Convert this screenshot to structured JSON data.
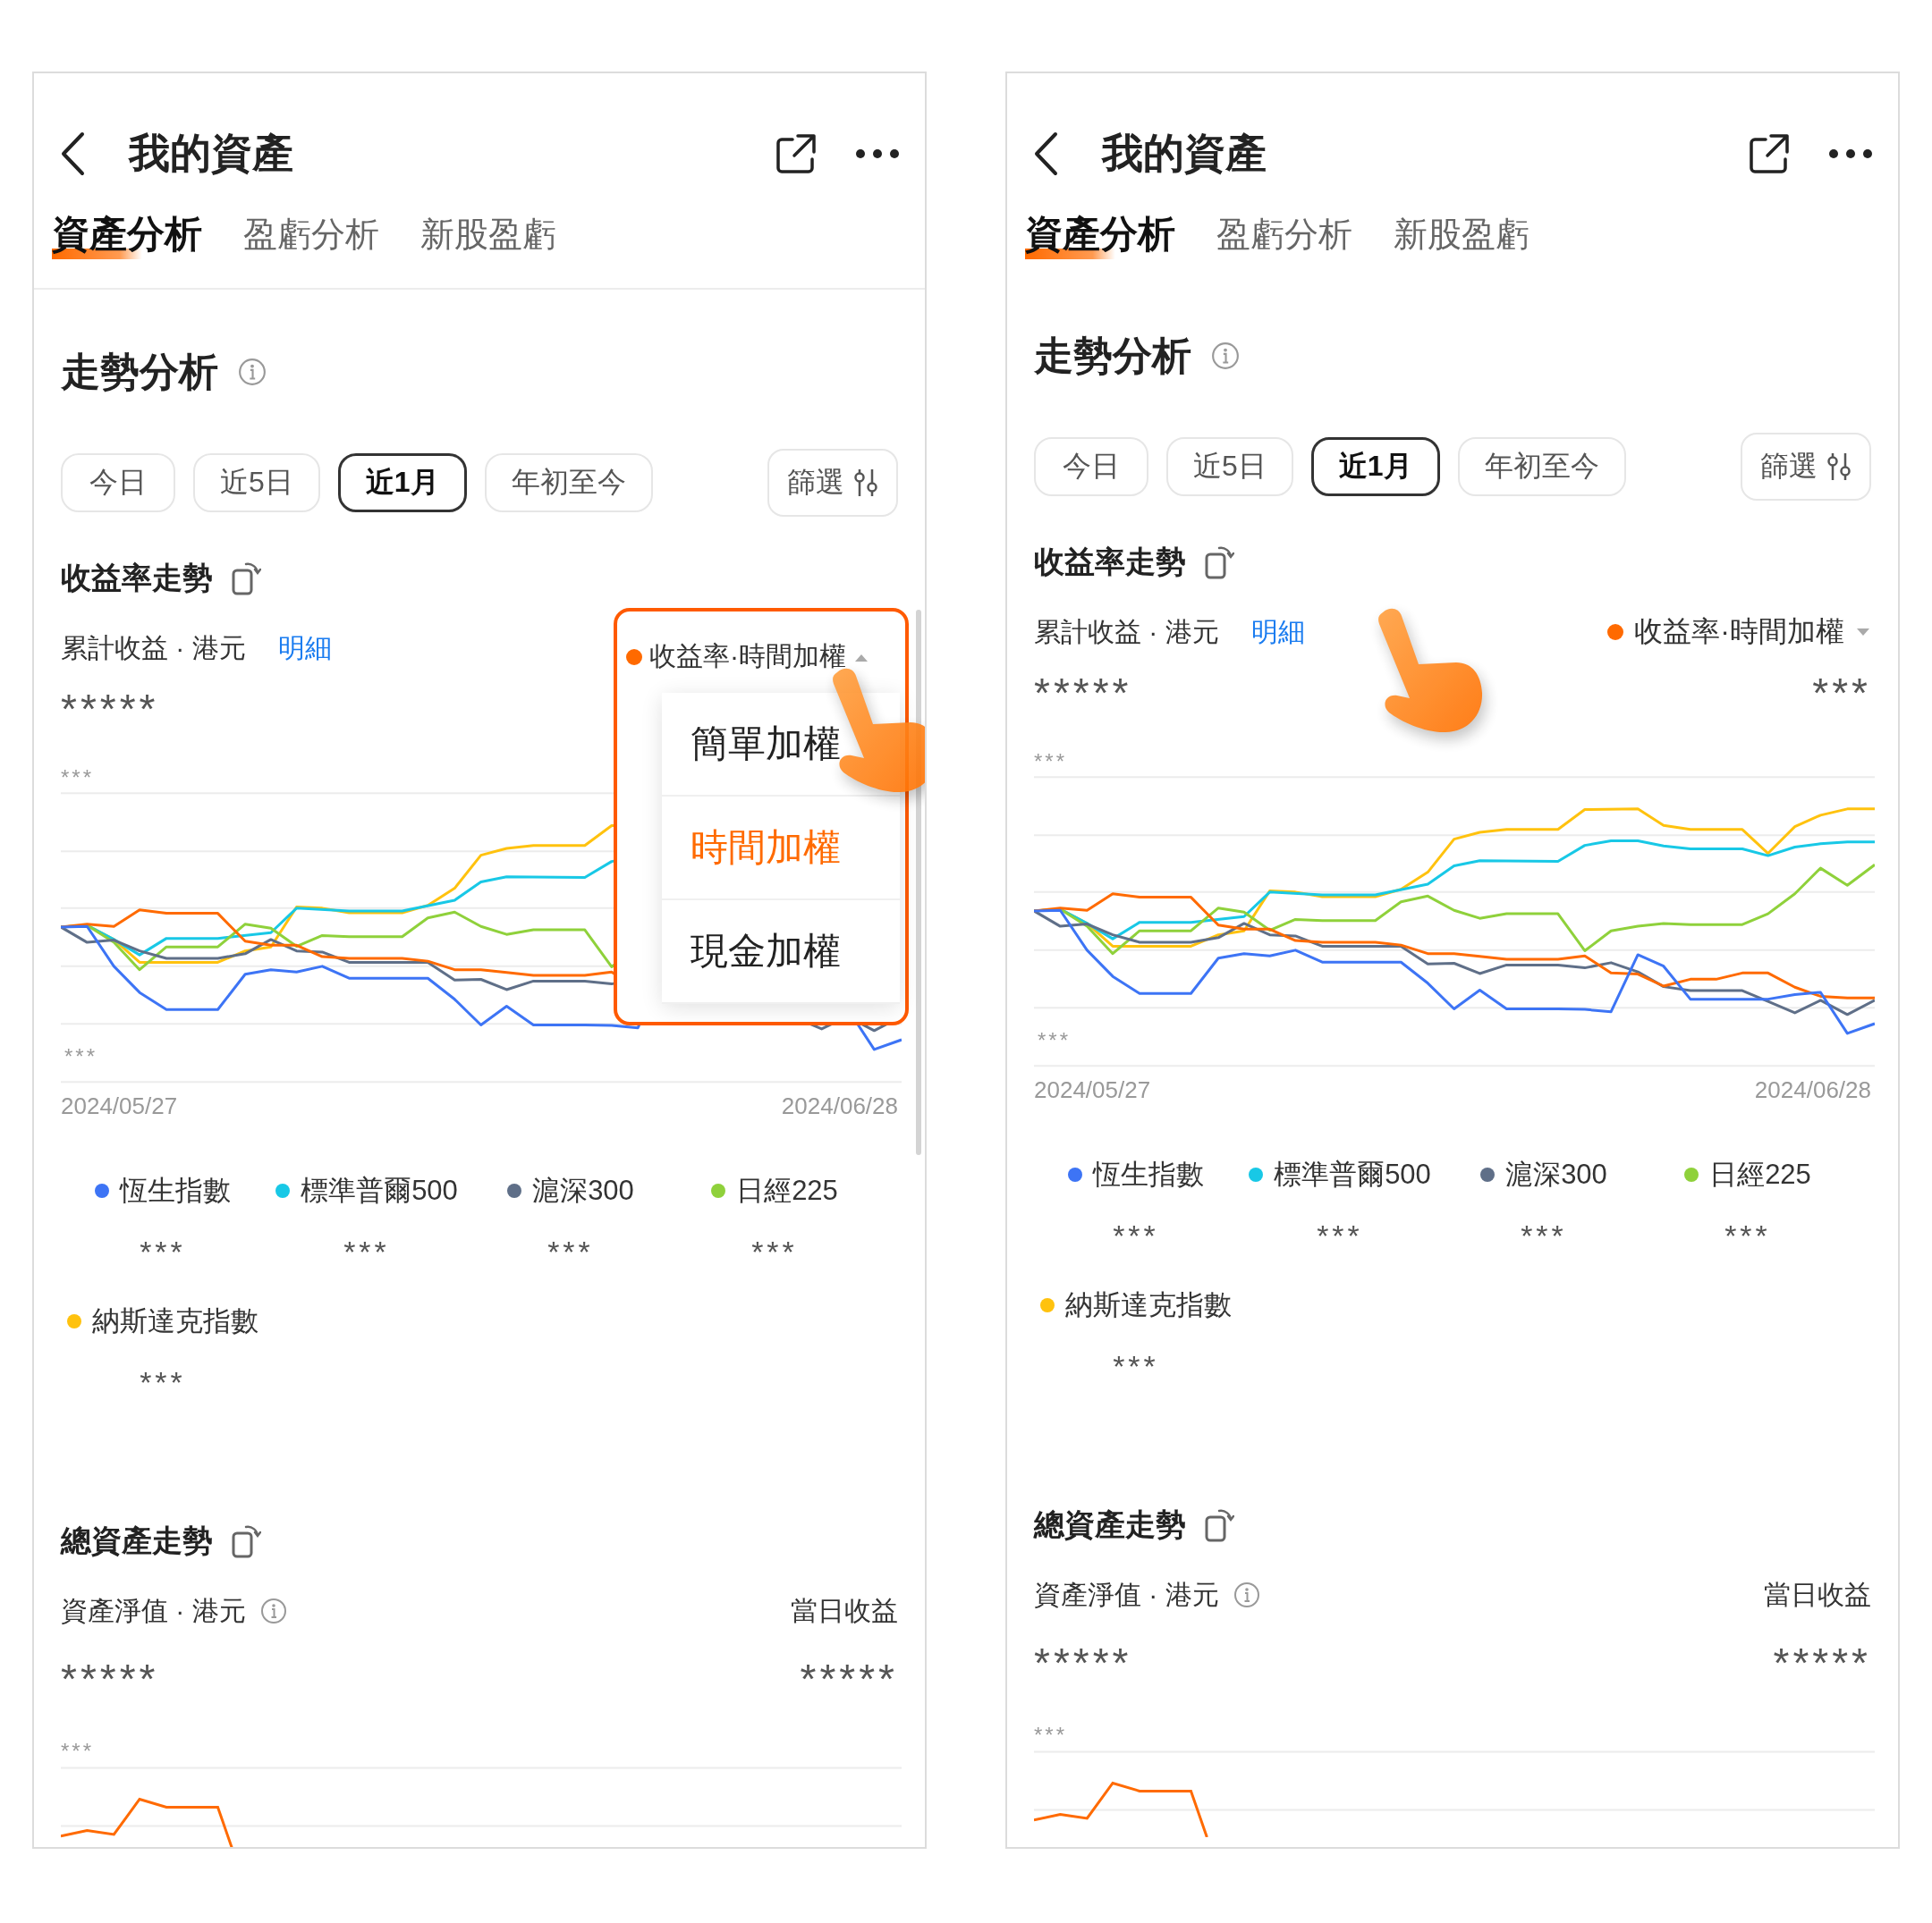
{
  "panels": [
    {
      "title": "我的資產",
      "tabs": [
        {
          "label": "資產分析",
          "selected": true
        },
        {
          "label": "盈虧分析",
          "selected": false
        },
        {
          "label": "新股盈虧",
          "selected": false
        }
      ],
      "tab_divider": true,
      "section_title": "走勢分析",
      "periods": [
        {
          "label": "今日",
          "selected": false
        },
        {
          "label": "近5日",
          "selected": false
        },
        {
          "label": "近1月",
          "selected": true
        },
        {
          "label": "年初至今",
          "selected": false
        }
      ],
      "filter": "篩選",
      "return_trend": {
        "title": "收益率走勢",
        "subtitle": "累計收益 · 港元",
        "detail_link": "明細",
        "detail_pointed": false,
        "selector": {
          "label": "收益率·時間加權",
          "expanded": true,
          "pointed": true,
          "options": [
            {
              "label": "簡單加權",
              "selected": false
            },
            {
              "label": "時間加權",
              "selected": true
            },
            {
              "label": "現金加權",
              "selected": false
            }
          ]
        },
        "value": "*****",
        "chart": {
          "top_label": "***",
          "bottom_label": "***",
          "start_date": "2024/05/27",
          "end_date": "2024/06/28"
        },
        "legend": [
          {
            "name": "恆生指數",
            "color": "#3d74f5",
            "value": "***"
          },
          {
            "name": "標準普爾500",
            "color": "#18c8e6",
            "value": "***"
          },
          {
            "name": "滬深300",
            "color": "#5f6f88",
            "value": "***"
          },
          {
            "name": "日經225",
            "color": "#8fd13b",
            "value": "***"
          },
          {
            "name": "納斯達克指數",
            "color": "#ffc20e",
            "value": "***"
          }
        ]
      },
      "asset_trend": {
        "title": "總資產走勢",
        "subtitle": "資產淨值 · 港元",
        "right_label": "當日收益",
        "value": "*****",
        "value_right": "*****",
        "chart_label": "***"
      },
      "scrollbar": true
    },
    {
      "title": "我的資產",
      "tabs": [
        {
          "label": "資產分析",
          "selected": true
        },
        {
          "label": "盈虧分析",
          "selected": false
        },
        {
          "label": "新股盈虧",
          "selected": false
        }
      ],
      "tab_divider": false,
      "section_title": "走勢分析",
      "periods": [
        {
          "label": "今日",
          "selected": false
        },
        {
          "label": "近5日",
          "selected": false
        },
        {
          "label": "近1月",
          "selected": true
        },
        {
          "label": "年初至今",
          "selected": false
        }
      ],
      "filter": "篩選",
      "return_trend": {
        "title": "收益率走勢",
        "subtitle": "累計收益 · 港元",
        "detail_link": "明細",
        "detail_pointed": true,
        "selector": {
          "label": "收益率·時間加權",
          "expanded": false,
          "pointed": false
        },
        "value": "*****",
        "value_right": "***",
        "chart": {
          "top_label": "***",
          "bottom_label": "***",
          "start_date": "2024/05/27",
          "end_date": "2024/06/28"
        },
        "legend": [
          {
            "name": "恆生指數",
            "color": "#3d74f5",
            "value": "***"
          },
          {
            "name": "標準普爾500",
            "color": "#18c8e6",
            "value": "***"
          },
          {
            "name": "滬深300",
            "color": "#5f6f88",
            "value": "***"
          },
          {
            "name": "日經225",
            "color": "#8fd13b",
            "value": "***"
          },
          {
            "name": "納斯達克指數",
            "color": "#ffc20e",
            "value": "***"
          }
        ]
      },
      "asset_trend": {
        "title": "總資產走勢",
        "subtitle": "資產淨值 · 港元",
        "right_label": "當日收益",
        "value": "*****",
        "value_right": "*****",
        "chart_label": "***"
      },
      "scrollbar": false
    }
  ]
}
